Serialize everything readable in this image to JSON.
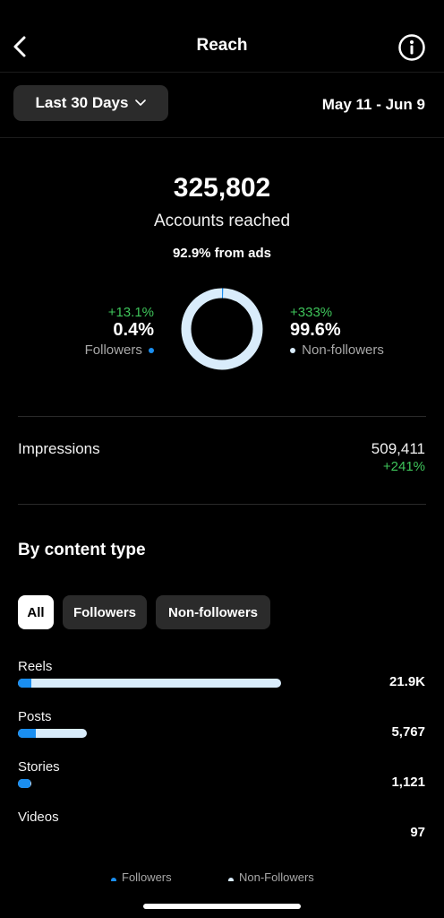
{
  "header": {
    "title": "Reach"
  },
  "filter": {
    "label": "Last 30 Days",
    "date_range": "May 11 - Jun 9"
  },
  "summary": {
    "accounts_reached": "325,802",
    "accounts_reached_label": "Accounts reached",
    "from_ads": "92.9% from ads",
    "followers": {
      "change": "+13.1%",
      "percent": "0.4%",
      "label": "Followers",
      "share": 0.004
    },
    "non_followers": {
      "change": "+333%",
      "percent": "99.6%",
      "label": "Non-followers",
      "share": 0.996
    }
  },
  "impressions": {
    "label": "Impressions",
    "value": "509,411",
    "change": "+241%"
  },
  "content": {
    "title": "By content type",
    "chips": [
      "All",
      "Followers",
      "Non-followers"
    ],
    "rows": [
      {
        "label": "Reels",
        "value": "21.9K",
        "total": 21900,
        "followers_share": 0.05
      },
      {
        "label": "Posts",
        "value": "5,767",
        "total": 5767,
        "followers_share": 0.26
      },
      {
        "label": "Stories",
        "value": "1,121",
        "total": 1121,
        "followers_share": 0.6
      },
      {
        "label": "Videos",
        "value": "97",
        "total": 97,
        "followers_share": 0
      }
    ],
    "legend": {
      "followers": "Followers",
      "non_followers": "Non-Followers"
    }
  },
  "colors": {
    "followers": "#1a8ef0",
    "non_followers": "#d9ecfb",
    "positive": "#3ec45a",
    "background": "#000000"
  },
  "icons": {
    "back": "chevron-left-icon",
    "info": "info-circle-icon",
    "dropdown": "chevron-down-icon"
  }
}
